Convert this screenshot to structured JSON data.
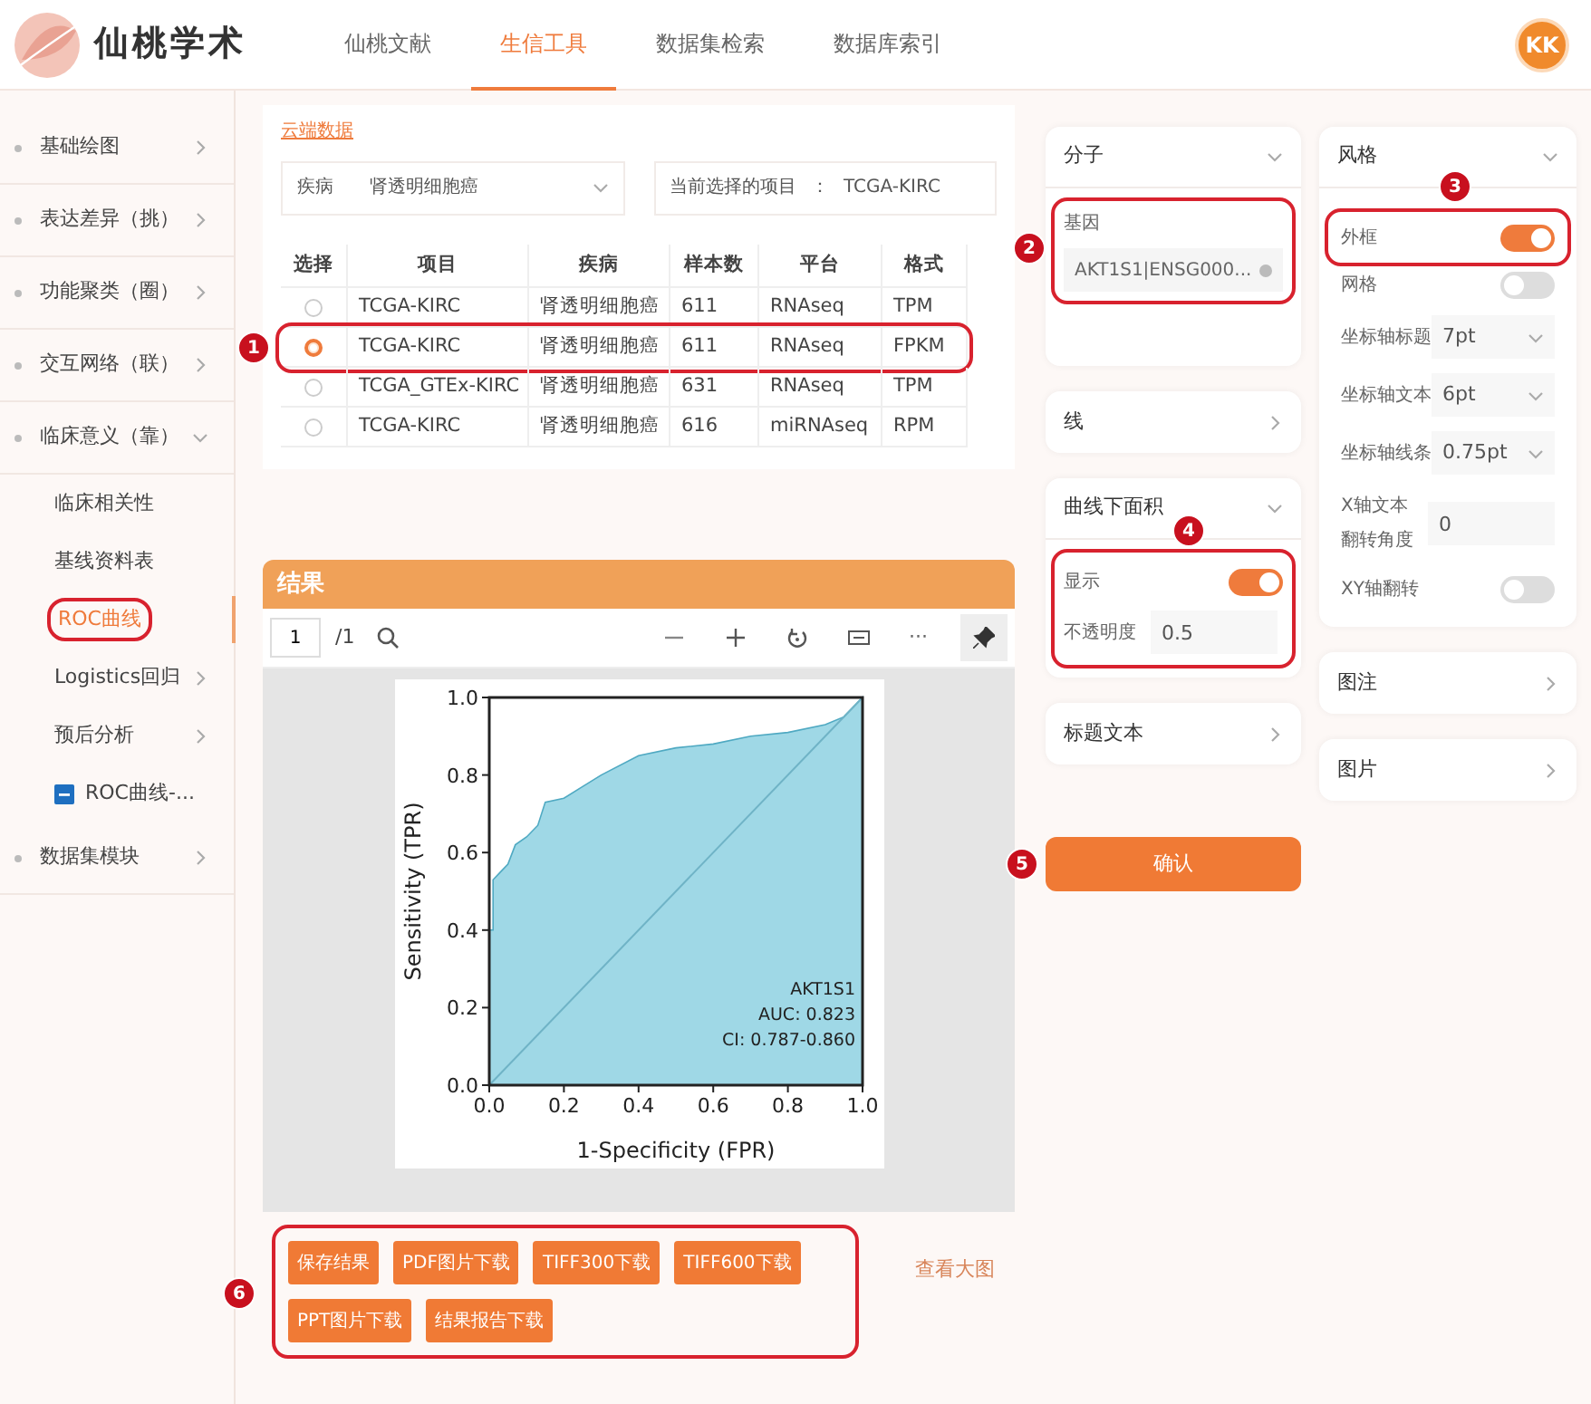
{
  "header": {
    "logo_text": "仙桃学术",
    "tabs": [
      {
        "label": "仙桃文献",
        "selected": false
      },
      {
        "label": "生信工具",
        "selected": true
      },
      {
        "label": "数据集检索",
        "selected": false
      },
      {
        "label": "数据库索引",
        "selected": false
      }
    ],
    "avatar": "KK"
  },
  "sidebar": {
    "items": [
      {
        "label": "基础绘图",
        "expanded": false
      },
      {
        "label": "表达差异（挑）",
        "expanded": false
      },
      {
        "label": "功能聚类（圈）",
        "expanded": false
      },
      {
        "label": "交互网络（联）",
        "expanded": false
      },
      {
        "label": "临床意义（靠）",
        "expanded": true,
        "children": [
          {
            "label": "临床相关性",
            "selected": false
          },
          {
            "label": "基线资料表",
            "selected": false
          },
          {
            "label": "ROC曲线",
            "selected": true,
            "highlighted": true
          },
          {
            "label": "Logistics回归",
            "selected": false,
            "expanded": false
          },
          {
            "label": "预后分析",
            "selected": false,
            "expanded": false
          },
          {
            "label": "ROC曲线-...",
            "selected": false,
            "kind": "report"
          }
        ]
      },
      {
        "label": "数据集模块",
        "expanded": false
      }
    ]
  },
  "cloud_data": {
    "title": "云端数据",
    "disease_field": {
      "label": "疾病",
      "value": "肾透明细胞癌"
    },
    "current_project": {
      "label": "当前选择的项目",
      "separator": "：",
      "value": "TCGA-KIRC"
    },
    "table": {
      "columns": [
        "选择",
        "项目",
        "疾病",
        "样本数",
        "平台",
        "格式"
      ],
      "rows": [
        {
          "selected": false,
          "cells": [
            "",
            "TCGA-KIRC",
            "肾透明细胞癌",
            "611",
            "RNAseq",
            "TPM"
          ]
        },
        {
          "selected": true,
          "highlighted": true,
          "callout": "1",
          "cells": [
            "",
            "TCGA-KIRC",
            "肾透明细胞癌",
            "611",
            "RNAseq",
            "FPKM"
          ]
        },
        {
          "selected": false,
          "cells": [
            "",
            "TCGA_GTEx-KIRC",
            "肾透明细胞癌",
            "631",
            "RNAseq",
            "TPM"
          ]
        },
        {
          "selected": false,
          "cells": [
            "",
            "TCGA-KIRC",
            "肾透明细胞癌",
            "616",
            "miRNAseq",
            "RPM"
          ]
        }
      ]
    }
  },
  "results": {
    "title": "结果",
    "toolbar": {
      "page": "1",
      "page_total": "/1",
      "more": "···"
    },
    "chart_data": {
      "type": "area",
      "xlabel": "1-Specificity (FPR)",
      "ylabel": "Sensitivity (TPR)",
      "x": [
        0,
        0,
        0.01,
        0.01,
        0.03,
        0.05,
        0.07,
        0.1,
        0.13,
        0.15,
        0.2,
        0.25,
        0.3,
        0.4,
        0.5,
        0.6,
        0.7,
        0.8,
        0.9,
        0.95,
        1
      ],
      "series": [
        {
          "name": "AKT1S1",
          "color": "#9fd8e6",
          "values": [
            0,
            0.4,
            0.4,
            0.53,
            0.55,
            0.57,
            0.62,
            0.64,
            0.67,
            0.73,
            0.74,
            0.77,
            0.8,
            0.85,
            0.87,
            0.88,
            0.9,
            0.91,
            0.93,
            0.95,
            1
          ]
        }
      ],
      "xlim": [
        0,
        1
      ],
      "ylim": [
        0,
        1
      ],
      "xticks": [
        {
          "value": 0,
          "label": "0.0"
        },
        {
          "value": 0.2,
          "label": "0.2"
        },
        {
          "value": 0.4,
          "label": "0.4"
        },
        {
          "value": 0.6,
          "label": "0.6"
        },
        {
          "value": 0.8,
          "label": "0.8"
        },
        {
          "value": 1,
          "label": "1.0"
        }
      ],
      "yticks": [
        {
          "value": 0,
          "label": "0.0"
        },
        {
          "value": 0.2,
          "label": "0.2"
        },
        {
          "value": 0.4,
          "label": "0.4"
        },
        {
          "value": 0.6,
          "label": "0.6"
        },
        {
          "value": 0.8,
          "label": "0.8"
        },
        {
          "value": 1,
          "label": "1.0"
        }
      ],
      "annotations": [
        "AUC: 0.823",
        "CI: 0.787-0.860"
      ]
    }
  },
  "downloads": {
    "highlighted": true,
    "callout": "6",
    "buttons": [
      "保存结果",
      "PDF图片下载",
      "TIFF300下载",
      "TIFF600下载",
      "PPT图片下载",
      "结果报告下载"
    ],
    "link": "查看大图"
  },
  "molecule_panel": {
    "title": "分子",
    "expanded": true,
    "gene": {
      "label": "基因",
      "value": "AKT1S1|ENSG000...",
      "highlighted": true,
      "callout": "2"
    }
  },
  "line_panel": {
    "title": "线",
    "expanded": false
  },
  "auc_panel": {
    "title": "曲线下面积",
    "expanded": true,
    "highlighted": true,
    "callout": "4",
    "show": {
      "label": "显示",
      "on": true
    },
    "opacity": {
      "label": "不透明度",
      "value": "0.5"
    }
  },
  "title_panel": {
    "title": "标题文本",
    "expanded": false
  },
  "confirm": {
    "label": "确认",
    "callout": "5"
  },
  "style_panel": {
    "title": "风格",
    "expanded": true,
    "rows": [
      {
        "kind": "toggle",
        "label": "外框",
        "on": true,
        "highlighted": true,
        "callout": "3"
      },
      {
        "kind": "toggle",
        "label": "网格",
        "on": false
      },
      {
        "kind": "select",
        "label": "坐标轴标题",
        "value": "7pt"
      },
      {
        "kind": "select",
        "label": "坐标轴文本",
        "value": "6pt"
      },
      {
        "kind": "select",
        "label": "坐标轴线条",
        "value": "0.75pt"
      },
      {
        "kind": "input",
        "label": "X轴文本翻转角度",
        "value": "0"
      },
      {
        "kind": "toggle",
        "label": "XY轴翻转",
        "on": false
      }
    ]
  },
  "legend_panel": {
    "title": "图注",
    "expanded": false
  },
  "image_panel": {
    "title": "图片",
    "expanded": false
  }
}
